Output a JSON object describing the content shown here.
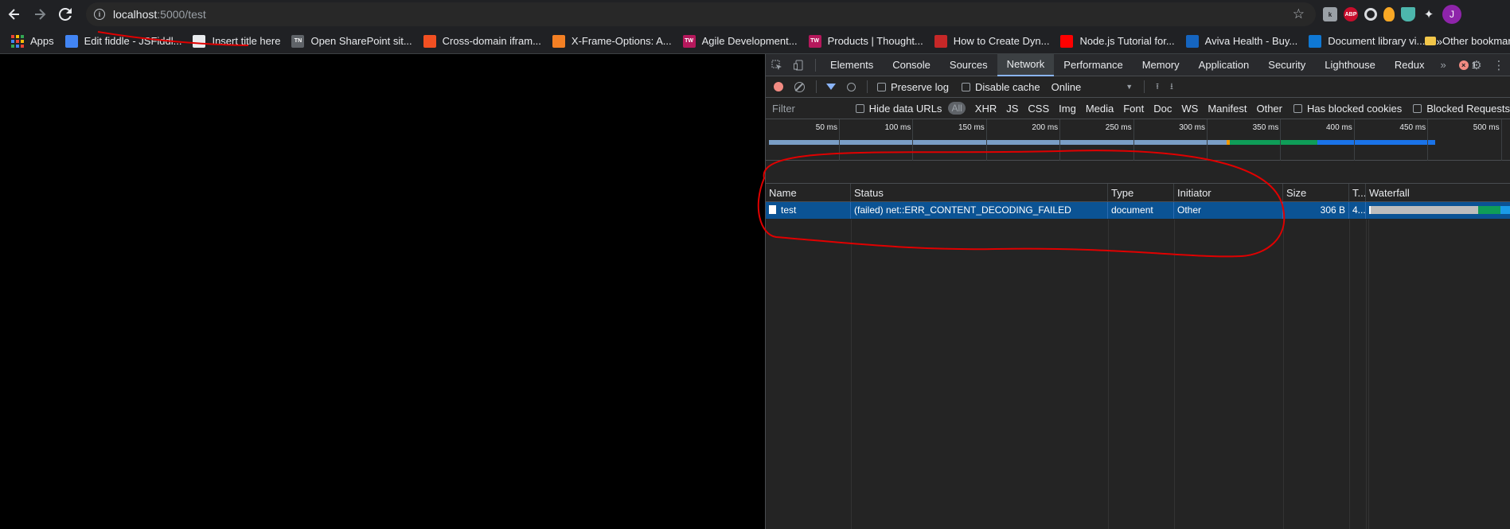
{
  "browser": {
    "url_host": "localhost",
    "url_path": ":5000/test",
    "avatar_initial": "J",
    "ext_abp": "ABP"
  },
  "bookmarks": [
    {
      "label": "Apps",
      "icon": "apps-grid-icon"
    },
    {
      "label": "Edit fiddle - JSFiddl...",
      "icon": "cloud-icon",
      "color": "#4285f4"
    },
    {
      "label": "Insert title here",
      "icon": "globe-icon",
      "color": "#e8eaed"
    },
    {
      "label": "Open SharePoint sit...",
      "icon": "tn-icon",
      "color": "#5f6368",
      "badge": "TN"
    },
    {
      "label": "Cross-domain ifram...",
      "icon": "microsoft-icon",
      "color": "#f25022"
    },
    {
      "label": "X-Frame-Options: A...",
      "icon": "stackoverflow-icon",
      "color": "#f48024"
    },
    {
      "label": "Agile Development...",
      "icon": "tw-icon",
      "color": "#b5185c",
      "badge": "TW"
    },
    {
      "label": "Products | Thought...",
      "icon": "tw-icon",
      "color": "#b5185c",
      "badge": "TW"
    },
    {
      "label": "How to Create Dyn...",
      "icon": "bolt-icon",
      "color": "#c62828"
    },
    {
      "label": "Node.js Tutorial for...",
      "icon": "youtube-icon",
      "color": "#ff0000"
    },
    {
      "label": "Aviva Health - Buy...",
      "icon": "aviva-icon",
      "color": "#1565c0"
    },
    {
      "label": "Document library vi...",
      "icon": "sharepoint-icon",
      "color": "#0f78d4"
    }
  ],
  "bookmarks_more": "»",
  "other_bookmarks": "Other bookmarks",
  "devtools": {
    "tabs": [
      "Elements",
      "Console",
      "Sources",
      "Network",
      "Performance",
      "Memory",
      "Application",
      "Security",
      "Lighthouse",
      "Redux"
    ],
    "active_tab": "Network",
    "error_count": "1",
    "preserve_log": "Preserve log",
    "disable_cache": "Disable cache",
    "throttling": "Online",
    "filter_placeholder": "Filter",
    "hide_data_urls": "Hide data URLs",
    "type_all": "All",
    "types": [
      "XHR",
      "JS",
      "CSS",
      "Img",
      "Media",
      "Font",
      "Doc",
      "WS",
      "Manifest",
      "Other"
    ],
    "has_blocked_cookies": "Has blocked cookies",
    "blocked_requests": "Blocked Requests",
    "ruler_ticks": [
      "50 ms",
      "100 ms",
      "150 ms",
      "200 ms",
      "250 ms",
      "300 ms",
      "350 ms",
      "400 ms",
      "450 ms",
      "500 ms"
    ],
    "columns": [
      "Name",
      "Status",
      "Type",
      "Initiator",
      "Size",
      "T...",
      "Waterfall"
    ],
    "rows": [
      {
        "name": "test",
        "status": "(failed) net::ERR_CONTENT_DECODING_FAILED",
        "type": "document",
        "initiator": "Other",
        "size": "306 B",
        "time": "4..."
      }
    ]
  },
  "colors": {
    "annotation": "#e00000",
    "selected_row": "#0b5394",
    "bar_waiting": "#a8c7fa",
    "bar_receiving": "#1a73e8",
    "bar_green": "#0f9d58"
  }
}
